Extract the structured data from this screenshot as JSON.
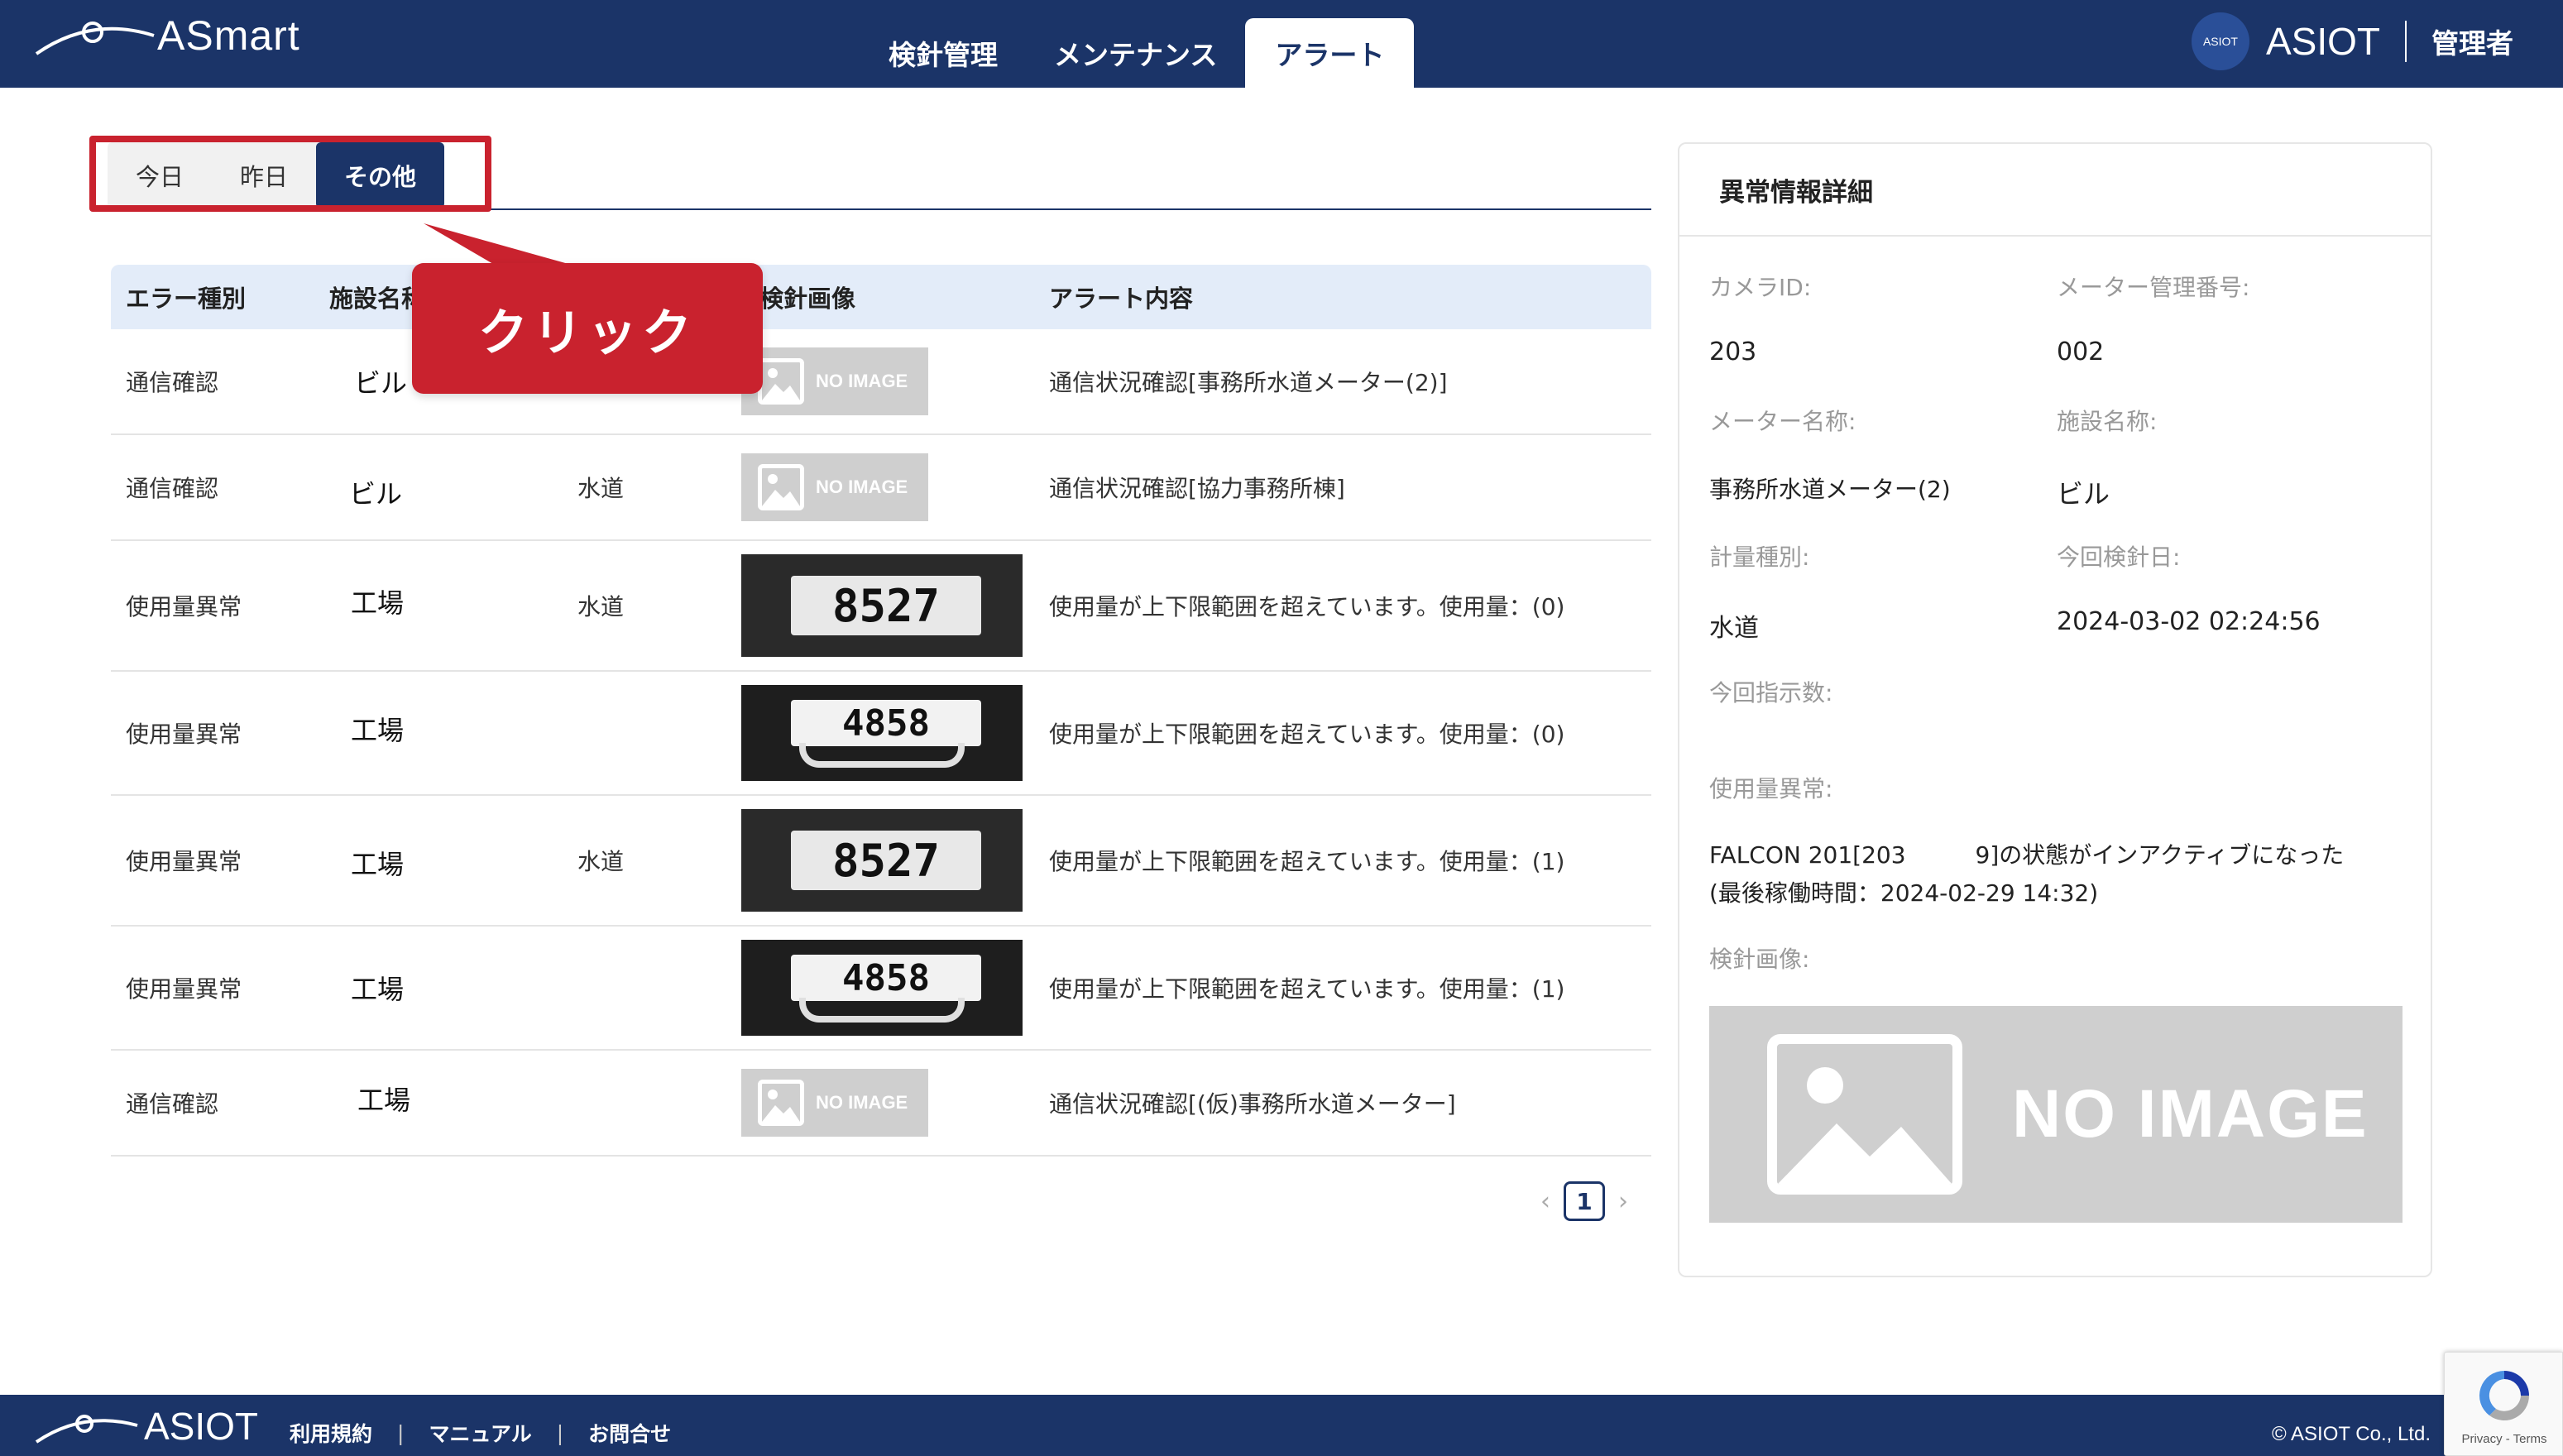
{
  "app": {
    "logo_text": "ASmart"
  },
  "nav": {
    "tabs": [
      {
        "label": "検針管理",
        "active": false
      },
      {
        "label": "メンテナンス",
        "active": false
      },
      {
        "label": "アラート",
        "active": true
      }
    ]
  },
  "brand": {
    "badge": "ASIOT",
    "name": "ASIOT",
    "user": "管理者"
  },
  "day_tabs": [
    {
      "label": "今日",
      "active": false
    },
    {
      "label": "昨日",
      "active": false
    },
    {
      "label": "その他",
      "active": true
    }
  ],
  "callout": {
    "text": "クリック"
  },
  "table": {
    "headers": [
      "エラー種別",
      "施設名称",
      "",
      "検針画像",
      "アラート内容"
    ],
    "rows": [
      {
        "type": "通信確認",
        "facility": "ビル",
        "meter_kind": "",
        "image": "no-image",
        "content": "通信状況確認[事務所水道メーター(2)]"
      },
      {
        "type": "通信確認",
        "facility": "ビル",
        "meter_kind": "水道",
        "image": "no-image",
        "content": "通信状況確認[協力事務所棟]"
      },
      {
        "type": "使用量異常",
        "facility": "工場",
        "meter_kind": "水道",
        "image": "meter-8527",
        "content": "使用量が上下限範囲を超えています。使用量：(0)"
      },
      {
        "type": "使用量異常",
        "facility": "工場",
        "meter_kind": "",
        "image": "meter-4858",
        "content": "使用量が上下限範囲を超えています。使用量：(0)"
      },
      {
        "type": "使用量異常",
        "facility": "工場",
        "meter_kind": "水道",
        "image": "meter-8527",
        "content": "使用量が上下限範囲を超えています。使用量：(1)"
      },
      {
        "type": "使用量異常",
        "facility": "工場",
        "meter_kind": "",
        "image": "meter-4858",
        "content": "使用量が上下限範囲を超えています。使用量：(1)"
      },
      {
        "type": "通信確認",
        "facility": "工場",
        "meter_kind": "",
        "image": "no-image",
        "content": "通信状況確認[(仮)事務所水道メーター]"
      }
    ],
    "no_image_label": "NO IMAGE",
    "meter_digits_a": "8527",
    "meter_digits_b": "4858"
  },
  "pagination": {
    "prev": "‹",
    "current": "1",
    "next": "›"
  },
  "detail": {
    "title": "異常情報詳細",
    "camera_id_label": "カメラID:",
    "camera_id": "203",
    "meter_no_label": "メーター管理番号:",
    "meter_no": "002",
    "meter_name_label": "メーター名称:",
    "meter_name": "事務所水道メーター(2)",
    "facility_label": "施設名称:",
    "facility": "ビル",
    "measure_type_label": "計量種別:",
    "measure_type": "水道",
    "check_date_label": "今回検針日:",
    "check_date": "2024-03-02 02:24:56",
    "reading_label": "今回指示数:",
    "reading": "",
    "usage_anomaly_label": "使用量異常:",
    "usage_anomaly_line1": "FALCON 201[203　　　9]の状態がインアクティブになった",
    "usage_anomaly_line2": "(最後稼働時間：2024-02-29 14:32)",
    "image_label": "検針画像:",
    "no_image_label": "NO IMAGE"
  },
  "footer": {
    "logo_text": "ASIOT",
    "links": [
      "利用規約",
      "マニュアル",
      "お問合せ"
    ],
    "copyright": "© ASIOT Co., Ltd."
  },
  "recaptcha": {
    "text": "Privacy - Terms"
  },
  "colors": {
    "navy": "#1b3468",
    "callout_red": "#c9222e",
    "table_header": "#e3ecf9"
  }
}
